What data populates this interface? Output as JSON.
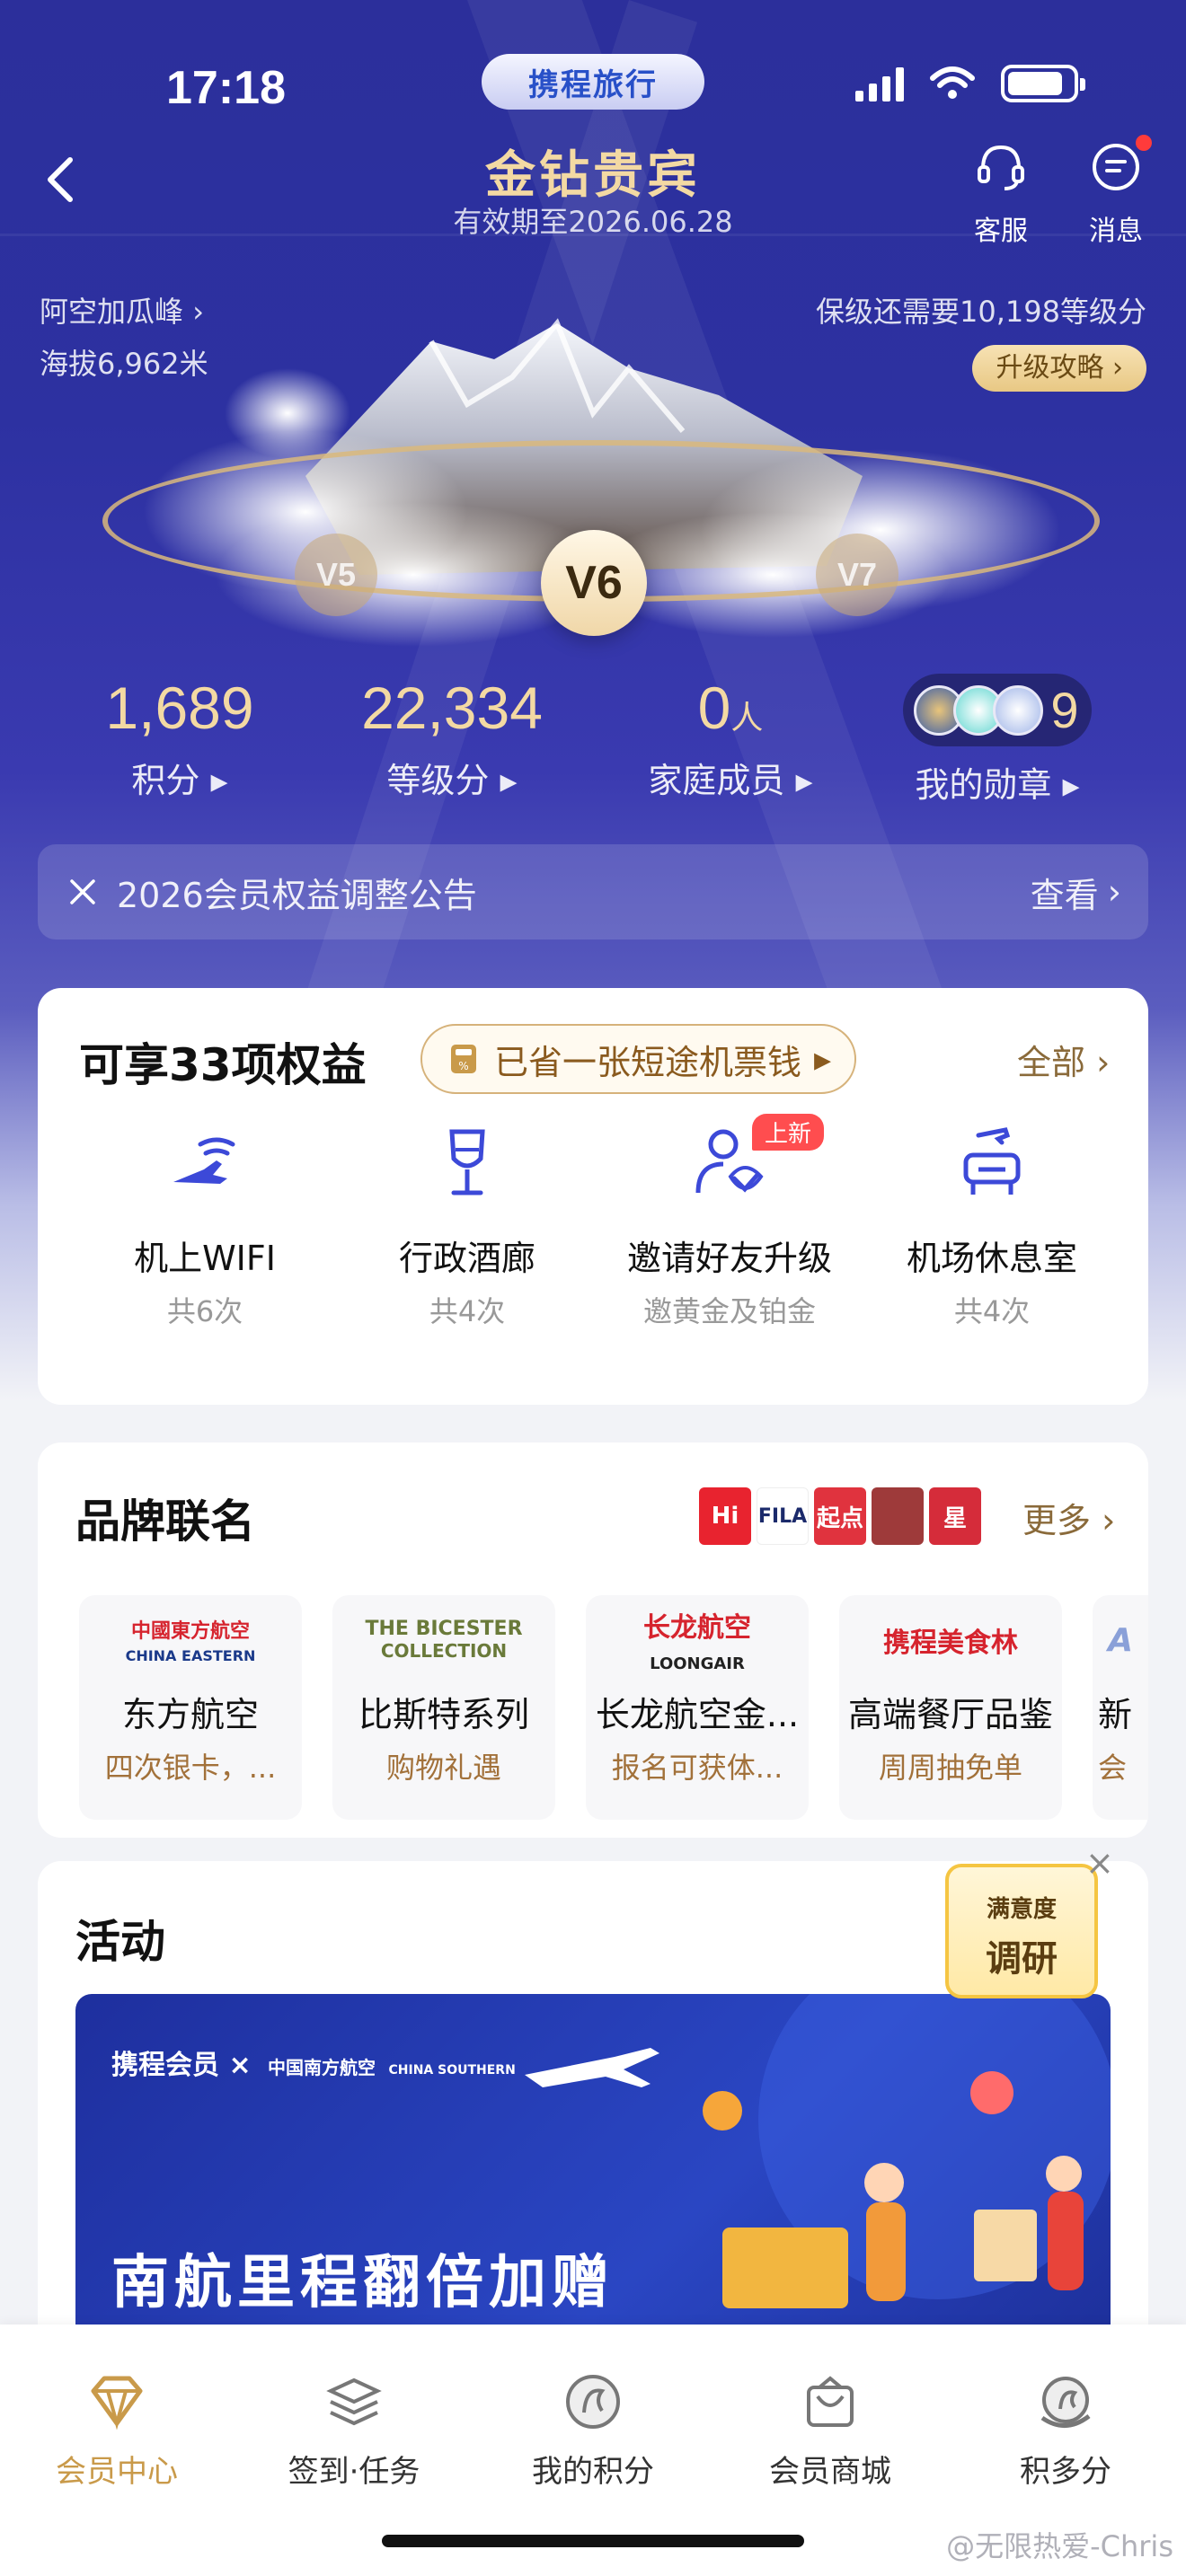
{
  "status": {
    "time": "17:18",
    "app_logo": "携程旅行"
  },
  "header": {
    "title": "金钻贵宾",
    "subtitle": "有效期至2026.06.28",
    "service_label": "客服",
    "message_label": "消息"
  },
  "peak": {
    "name": "阿空加瓜峰",
    "altitude": "海拔6,962米"
  },
  "level": {
    "requirement": "保级还需要10,198等级分",
    "upgrade_label": "升级攻略",
    "prev": "V5",
    "current": "V6",
    "next": "V7"
  },
  "stats": {
    "points_value": "1,689",
    "points_label": "积分",
    "grade_value": "22,334",
    "grade_label": "等级分",
    "family_value": "0",
    "family_unit": "人",
    "family_label": "家庭成员",
    "medals_value": "9",
    "medals_label": "我的勋章"
  },
  "notice": {
    "text": "2026会员权益调整公告",
    "action": "查看"
  },
  "benefits": {
    "title": "可享33项权益",
    "saved": "已省一张短途机票钱",
    "all_label": "全部",
    "items": [
      {
        "name": "机上WIFI",
        "sub": "共6次",
        "icon": "wifi-plane-icon"
      },
      {
        "name": "行政酒廊",
        "sub": "共4次",
        "icon": "wine-glass-icon"
      },
      {
        "name": "邀请好友升级",
        "sub": "邀黄金及铂金",
        "icon": "invite-user-icon",
        "tag": "上新"
      },
      {
        "name": "机场休息室",
        "sub": "共4次",
        "icon": "lounge-seat-icon"
      }
    ]
  },
  "brands": {
    "title": "品牌联名",
    "more_label": "更多",
    "strip_logos": [
      "Hi",
      "FILA",
      "起点",
      "",
      "星"
    ],
    "items": [
      {
        "name": "东方航空",
        "sub": "四次银卡，...",
        "logo_text": "中國東方航空",
        "logo_sub": "CHINA EASTERN"
      },
      {
        "name": "比斯特系列",
        "sub": "购物礼遇",
        "logo_text": "THE BICESTER",
        "logo_sub": "COLLECTION"
      },
      {
        "name": "长龙航空金...",
        "sub": "报名可获体...",
        "logo_text": "长龙航空",
        "logo_sub": "LOONGAIR"
      },
      {
        "name": "高端餐厅品鉴",
        "sub": "周周抽免单",
        "logo_text": "携程美食林",
        "logo_sub": ""
      },
      {
        "name": "新",
        "sub": "会",
        "logo_text": "A",
        "logo_sub": ""
      }
    ]
  },
  "activity": {
    "title": "活动",
    "banner_brand": "携程会员 ×",
    "banner_partner": "中国南方航空",
    "banner_partner_sub": "CHINA SOUTHERN",
    "banner_title": "南航里程翻倍加赠"
  },
  "survey": {
    "line1": "满意度",
    "line2": "调研"
  },
  "tabs": [
    {
      "label": "会员中心",
      "icon": "diamond-icon",
      "active": true
    },
    {
      "label": "签到·任务",
      "icon": "layers-icon",
      "active": false
    },
    {
      "label": "我的积分",
      "icon": "points-coin-icon",
      "active": false
    },
    {
      "label": "会员商城",
      "icon": "mall-bag-icon",
      "active": false
    },
    {
      "label": "积多分",
      "icon": "earn-points-icon",
      "active": false
    }
  ],
  "watermark": "@无限热爱-Chris",
  "colors": {
    "hero_blue": "#2c2f9b",
    "gold": "#f3d9a3",
    "accent_gold": "#c99a4a",
    "badge_red": "#ff4d4f"
  }
}
